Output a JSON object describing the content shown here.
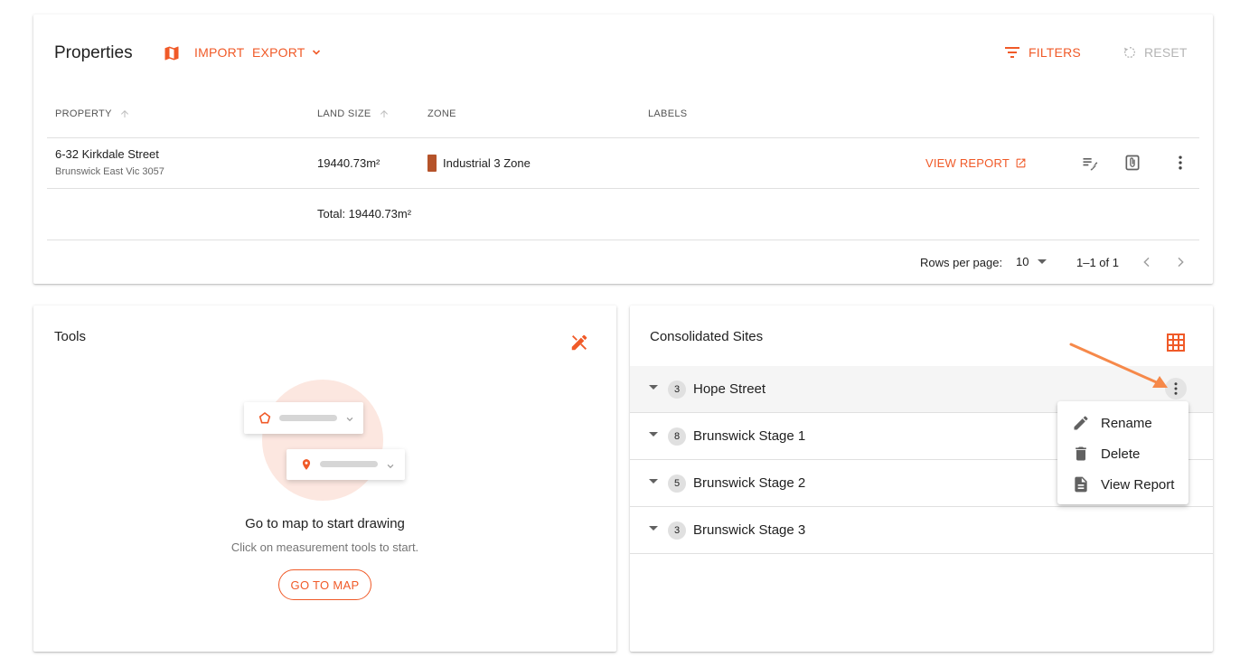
{
  "properties": {
    "title": "Properties",
    "import_label": "IMPORT",
    "export_label": "EXPORT",
    "filters_label": "FILTERS",
    "reset_label": "RESET",
    "columns": {
      "property": "PROPERTY",
      "land_size": "LAND SIZE",
      "zone": "ZONE",
      "labels": "LABELS"
    },
    "rows": [
      {
        "address": "6-32 Kirkdale Street",
        "suburb": "Brunswick East Vic 3057",
        "land_size": "19440.73m²",
        "zone": "Industrial 3 Zone",
        "zone_color": "#b5532a",
        "view_report_label": "VIEW REPORT"
      }
    ],
    "total": "Total: 19440.73m²",
    "pagination": {
      "rows_per_page_label": "Rows per page:",
      "rows_per_page_value": "10",
      "range": "1–1 of 1"
    }
  },
  "tools": {
    "title": "Tools",
    "heading": "Go to map to start drawing",
    "subtext": "Click on measurement tools to start.",
    "go_to_map_label": "GO TO MAP"
  },
  "consolidated_sites": {
    "title": "Consolidated Sites",
    "sites": [
      {
        "count": "3",
        "name": "Hope Street"
      },
      {
        "count": "8",
        "name": "Brunswick Stage 1"
      },
      {
        "count": "5",
        "name": "Brunswick Stage 2"
      },
      {
        "count": "3",
        "name": "Brunswick Stage 3"
      }
    ],
    "menu": [
      {
        "label": "Rename",
        "icon": "pencil-icon"
      },
      {
        "label": "Delete",
        "icon": "trash-icon"
      },
      {
        "label": "View Report",
        "icon": "document-icon"
      }
    ]
  },
  "colors": {
    "accent": "#f05a28",
    "arrow": "#f6894a",
    "muted": "#b4b4b4"
  }
}
